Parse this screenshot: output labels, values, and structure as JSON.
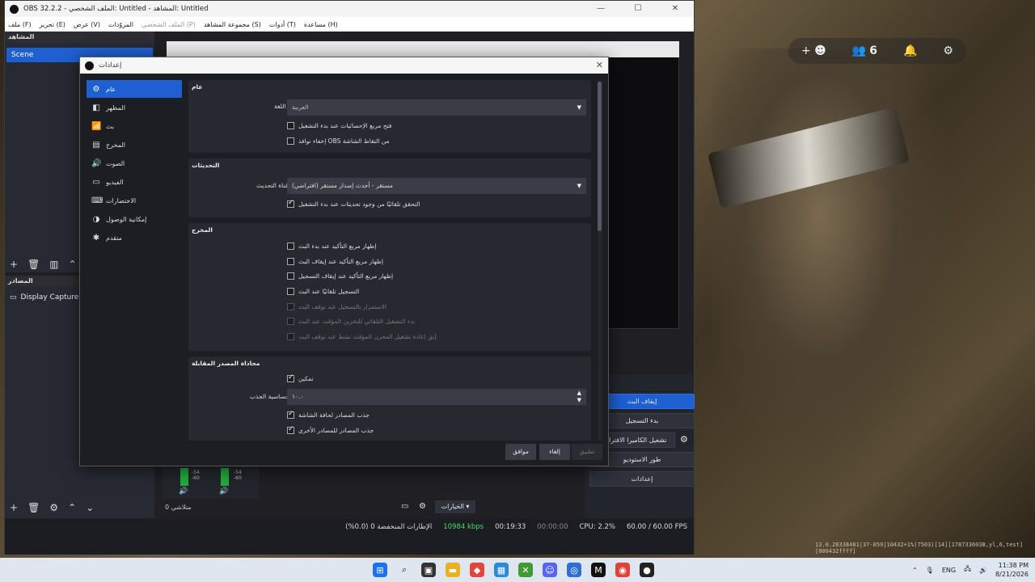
{
  "obs": {
    "title": "OBS 32.2.2 - الملف الشخصي: Untitled - المشاهد: Untitled",
    "menu": [
      "ملف (F)",
      "تحرير (E)",
      "عرض (V)",
      "المزوّدات",
      "الملف الشخصي (P)",
      "مجموعة المشاهد (S)",
      "أدوات (T)",
      "مساعدة (H)"
    ],
    "scenes_title": "المشاهد",
    "scene_item": "Scene",
    "sources_title": "المصادر",
    "source_item": "Display Capture",
    "controls": [
      "إيقاف البث",
      "بدء التسجيل",
      "تشغيل الكاميرا الافتراضية",
      "طور الاستوديو",
      "إعدادات"
    ],
    "mixer_values": [
      "-54",
      "-60",
      "-54",
      "-60"
    ],
    "transition_label": "متلاشي 0",
    "options_label": "الخيارات",
    "status": {
      "dropped": "الإطارات المنخفضة 0 (0.0%)",
      "bitrate": "10984 kbps",
      "stream_time": "00:19:33",
      "rec_time": "00:00:00",
      "cpu": "CPU: 2.2%",
      "fps": "60.00 / 60.00 FPS"
    }
  },
  "dialog": {
    "title": "إعدادات",
    "sidebar": [
      {
        "label": "عام",
        "icon": "⚙",
        "active": true
      },
      {
        "label": "المظهر",
        "icon": "◧",
        "active": false
      },
      {
        "label": "بث",
        "icon": "📶",
        "active": false
      },
      {
        "label": "المخرج",
        "icon": "▤",
        "active": false
      },
      {
        "label": "الصوت",
        "icon": "🔊",
        "active": false
      },
      {
        "label": "الفيديو",
        "icon": "▭",
        "active": false
      },
      {
        "label": "الاختصارات",
        "icon": "⌨",
        "active": false
      },
      {
        "label": "إمكانية الوصول",
        "icon": "◑",
        "active": false
      },
      {
        "label": "متقدم",
        "icon": "✱",
        "active": false
      }
    ],
    "general": {
      "title": "عام",
      "language_label": "اللغة",
      "language_value": "العربية",
      "check_stats": "فتح مربع الإحصائيات عند بدء التشغيل",
      "check_hide": "إخفاء نوافذ OBS من التقاط الشاشة"
    },
    "updates": {
      "title": "التحديثات",
      "channel_label": "قناة التحديث",
      "channel_value": "مستقر - أحدث إصدار مستقر (افتراضي)",
      "check_auto": "التحقق تلقائيًا من وجود تحديثات عند بدء التشغيل"
    },
    "output": {
      "title": "المخرج",
      "items": [
        {
          "label": "إظهار مربع التأكيد عند بدء البث",
          "checked": false,
          "disabled": false
        },
        {
          "label": "إظهار مربع التأكيد عند إيقاف البث",
          "checked": false,
          "disabled": false
        },
        {
          "label": "إظهار مربع التأكيد عند إيقاف التسجيل",
          "checked": false,
          "disabled": false
        },
        {
          "label": "التسجيل تلقائيًا عند البث",
          "checked": false,
          "disabled": false
        },
        {
          "label": "الاستمرار بالتسجيل عند توقف البث",
          "checked": false,
          "disabled": true
        },
        {
          "label": "بدء التشغيل التلقائي للتخزين المؤقت عند البث",
          "checked": false,
          "disabled": true
        },
        {
          "label": "إبق إعادة تشغيل المخزن المؤقت نشط عند توقف البث",
          "checked": false,
          "disabled": true
        }
      ]
    },
    "snapping": {
      "title": "محاذاة المصدر المقابلة",
      "enable": "تمكين",
      "sensitivity_label": "حساسية الجذب",
      "sensitivity_value": "١٠.٠",
      "snap_edges": "جذب المصادر لحافة الشاشة",
      "snap_others": "جذب المصادر للمصادر الأخرى"
    },
    "buttons": {
      "ok": "موافق",
      "cancel": "إلغاء",
      "apply": "تطبيق"
    }
  },
  "desktop": {
    "widget_count": "6",
    "watermark": "13.0.28338481|37-059|10432+1%(7503)[14][178733603B,yl,6,test][000432ffff]"
  },
  "taskbar": {
    "lang": "ENG",
    "time": "11:38 PM",
    "date": "8/21/2026"
  },
  "colors": {
    "accent": "#1e5fd1",
    "bg": "#1d1e24"
  }
}
